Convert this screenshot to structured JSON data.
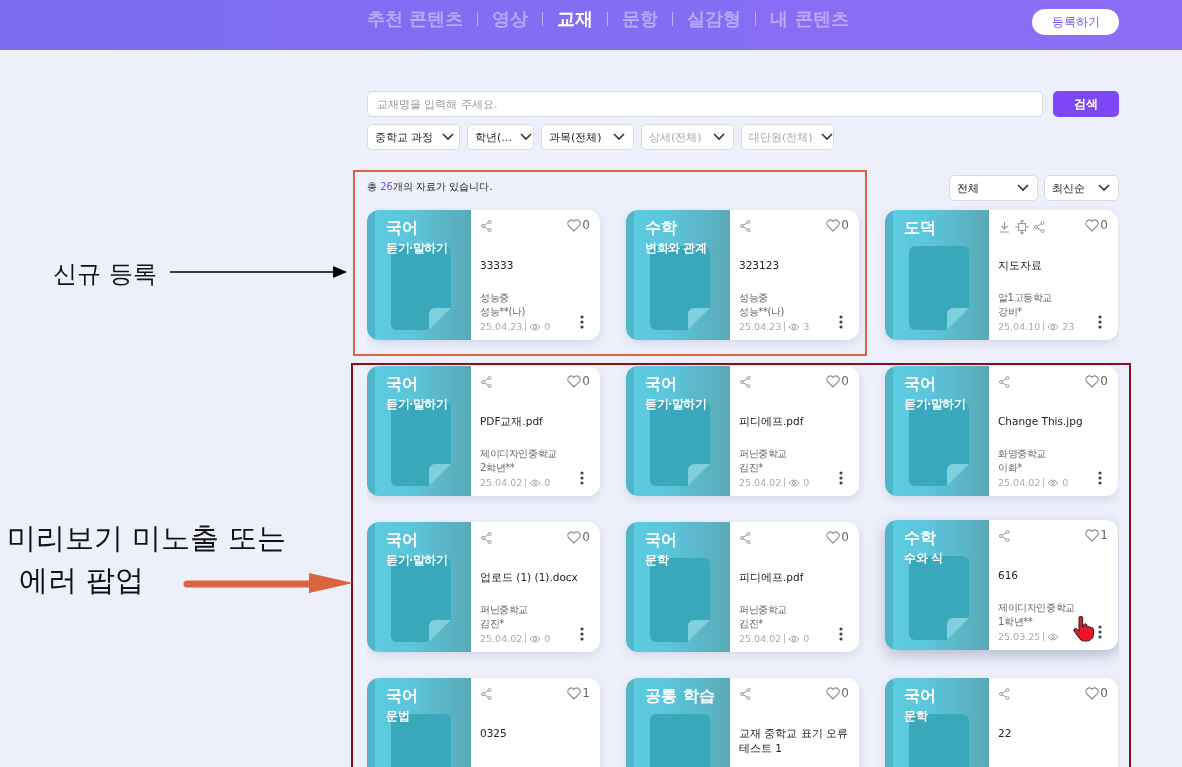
{
  "header": {
    "tabs": [
      {
        "label": "추천 콘텐츠",
        "selected": false
      },
      {
        "label": "영상",
        "selected": false
      },
      {
        "label": "교재",
        "selected": true
      },
      {
        "label": "문항",
        "selected": false
      },
      {
        "label": "실감형",
        "selected": false
      },
      {
        "label": "내 콘텐츠",
        "selected": false
      }
    ],
    "register_button": "등록하기"
  },
  "search": {
    "placeholder": "교재명을 입력해 주세요.",
    "button": "검색"
  },
  "filters": [
    {
      "label": "중학교 과정",
      "disabled": false
    },
    {
      "label": "학년(…",
      "disabled": false
    },
    {
      "label": "과목(전체)",
      "disabled": false
    },
    {
      "label": "상세(전체)",
      "disabled": true
    },
    {
      "label": "대단원(전체)",
      "disabled": true
    }
  ],
  "result_count": {
    "prefix": "총 ",
    "count": "26",
    "suffix": "개의 자료가 있습니다."
  },
  "sort": [
    {
      "label": "전체"
    },
    {
      "label": "최신순"
    }
  ],
  "cards": [
    {
      "subject": "국어",
      "topic": "듣기·말하기",
      "title": "33333",
      "school": "성능중",
      "author": "성능**(나)",
      "date": "25.04.23",
      "views": "0",
      "likes": "0",
      "tools": [
        {
          "kind": "share"
        }
      ],
      "hovered": false
    },
    {
      "subject": "수학",
      "topic": "변화와 관계",
      "title": "323123",
      "school": "성능중",
      "author": "성능**(나)",
      "date": "25.04.23",
      "views": "3",
      "likes": "0",
      "tools": [
        {
          "kind": "share"
        }
      ],
      "hovered": false
    },
    {
      "subject": "도덕",
      "title": "지도자료",
      "school": "알1고등학교",
      "author": "강비*",
      "date": "25.04.10",
      "views": "23",
      "likes": "0",
      "tools": [
        {
          "kind": "download"
        },
        {
          "kind": "move"
        },
        {
          "kind": "share"
        }
      ],
      "hovered": false
    },
    {
      "subject": "국어",
      "topic": "듣기·말하기",
      "title": "PDF교재.pdf",
      "school": "제이디자인중학교",
      "author": "2학년**",
      "date": "25.04.02",
      "views": "0",
      "likes": "0",
      "tools": [
        {
          "kind": "share"
        }
      ],
      "hovered": false
    },
    {
      "subject": "국어",
      "topic": "듣기·말하기",
      "title": "피디에프.pdf",
      "school": "퍼닌중학교",
      "author": "김진*",
      "date": "25.04.02",
      "views": "0",
      "likes": "0",
      "tools": [
        {
          "kind": "share"
        }
      ],
      "hovered": false
    },
    {
      "subject": "국어",
      "topic": "듣기·말하기",
      "title": "Change This.jpg",
      "school": "화영중학교",
      "author": "이화*",
      "date": "25.04.02",
      "views": "0",
      "likes": "0",
      "tools": [
        {
          "kind": "share"
        }
      ],
      "hovered": false
    },
    {
      "subject": "국어",
      "topic": "듣기·말하기",
      "title": "업로드 (1) (1).docx",
      "school": "퍼닌중학교",
      "author": "김진*",
      "date": "25.04.02",
      "views": "0",
      "likes": "0",
      "tools": [
        {
          "kind": "share"
        }
      ],
      "hovered": false
    },
    {
      "subject": "국어",
      "topic": "문학",
      "title": "피디에프.pdf",
      "school": "퍼닌중학교",
      "author": "김진*",
      "date": "25.04.02",
      "views": "0",
      "likes": "0",
      "tools": [
        {
          "kind": "share"
        }
      ],
      "hovered": false
    },
    {
      "subject": "수학",
      "topic": "수와 식",
      "title": "616",
      "school": "제이디자인중학교",
      "author": "1학년**",
      "date": "25.03.25",
      "likes": "1",
      "tools": [
        {
          "kind": "share"
        }
      ],
      "hovered": true
    },
    {
      "subject": "국어",
      "topic": "문법",
      "title": "0325",
      "likes": "1",
      "tools": [
        {
          "kind": "share"
        }
      ],
      "hovered": false
    },
    {
      "subject": "공통 학습",
      "title": "교재 중학교 표기 오류 테스트 1",
      "likes": "0",
      "tools": [
        {
          "kind": "share"
        }
      ],
      "hovered": false
    },
    {
      "subject": "국어",
      "topic": "문학",
      "title": "22",
      "likes": "0",
      "tools": [
        {
          "kind": "share"
        }
      ],
      "hovered": false
    }
  ],
  "annotations": [
    {
      "kind": "new",
      "lines": [
        "신규 등록"
      ]
    },
    {
      "kind": "error",
      "lines": [
        "미리보기 미노출 또는",
        "에러 팝업"
      ]
    }
  ]
}
